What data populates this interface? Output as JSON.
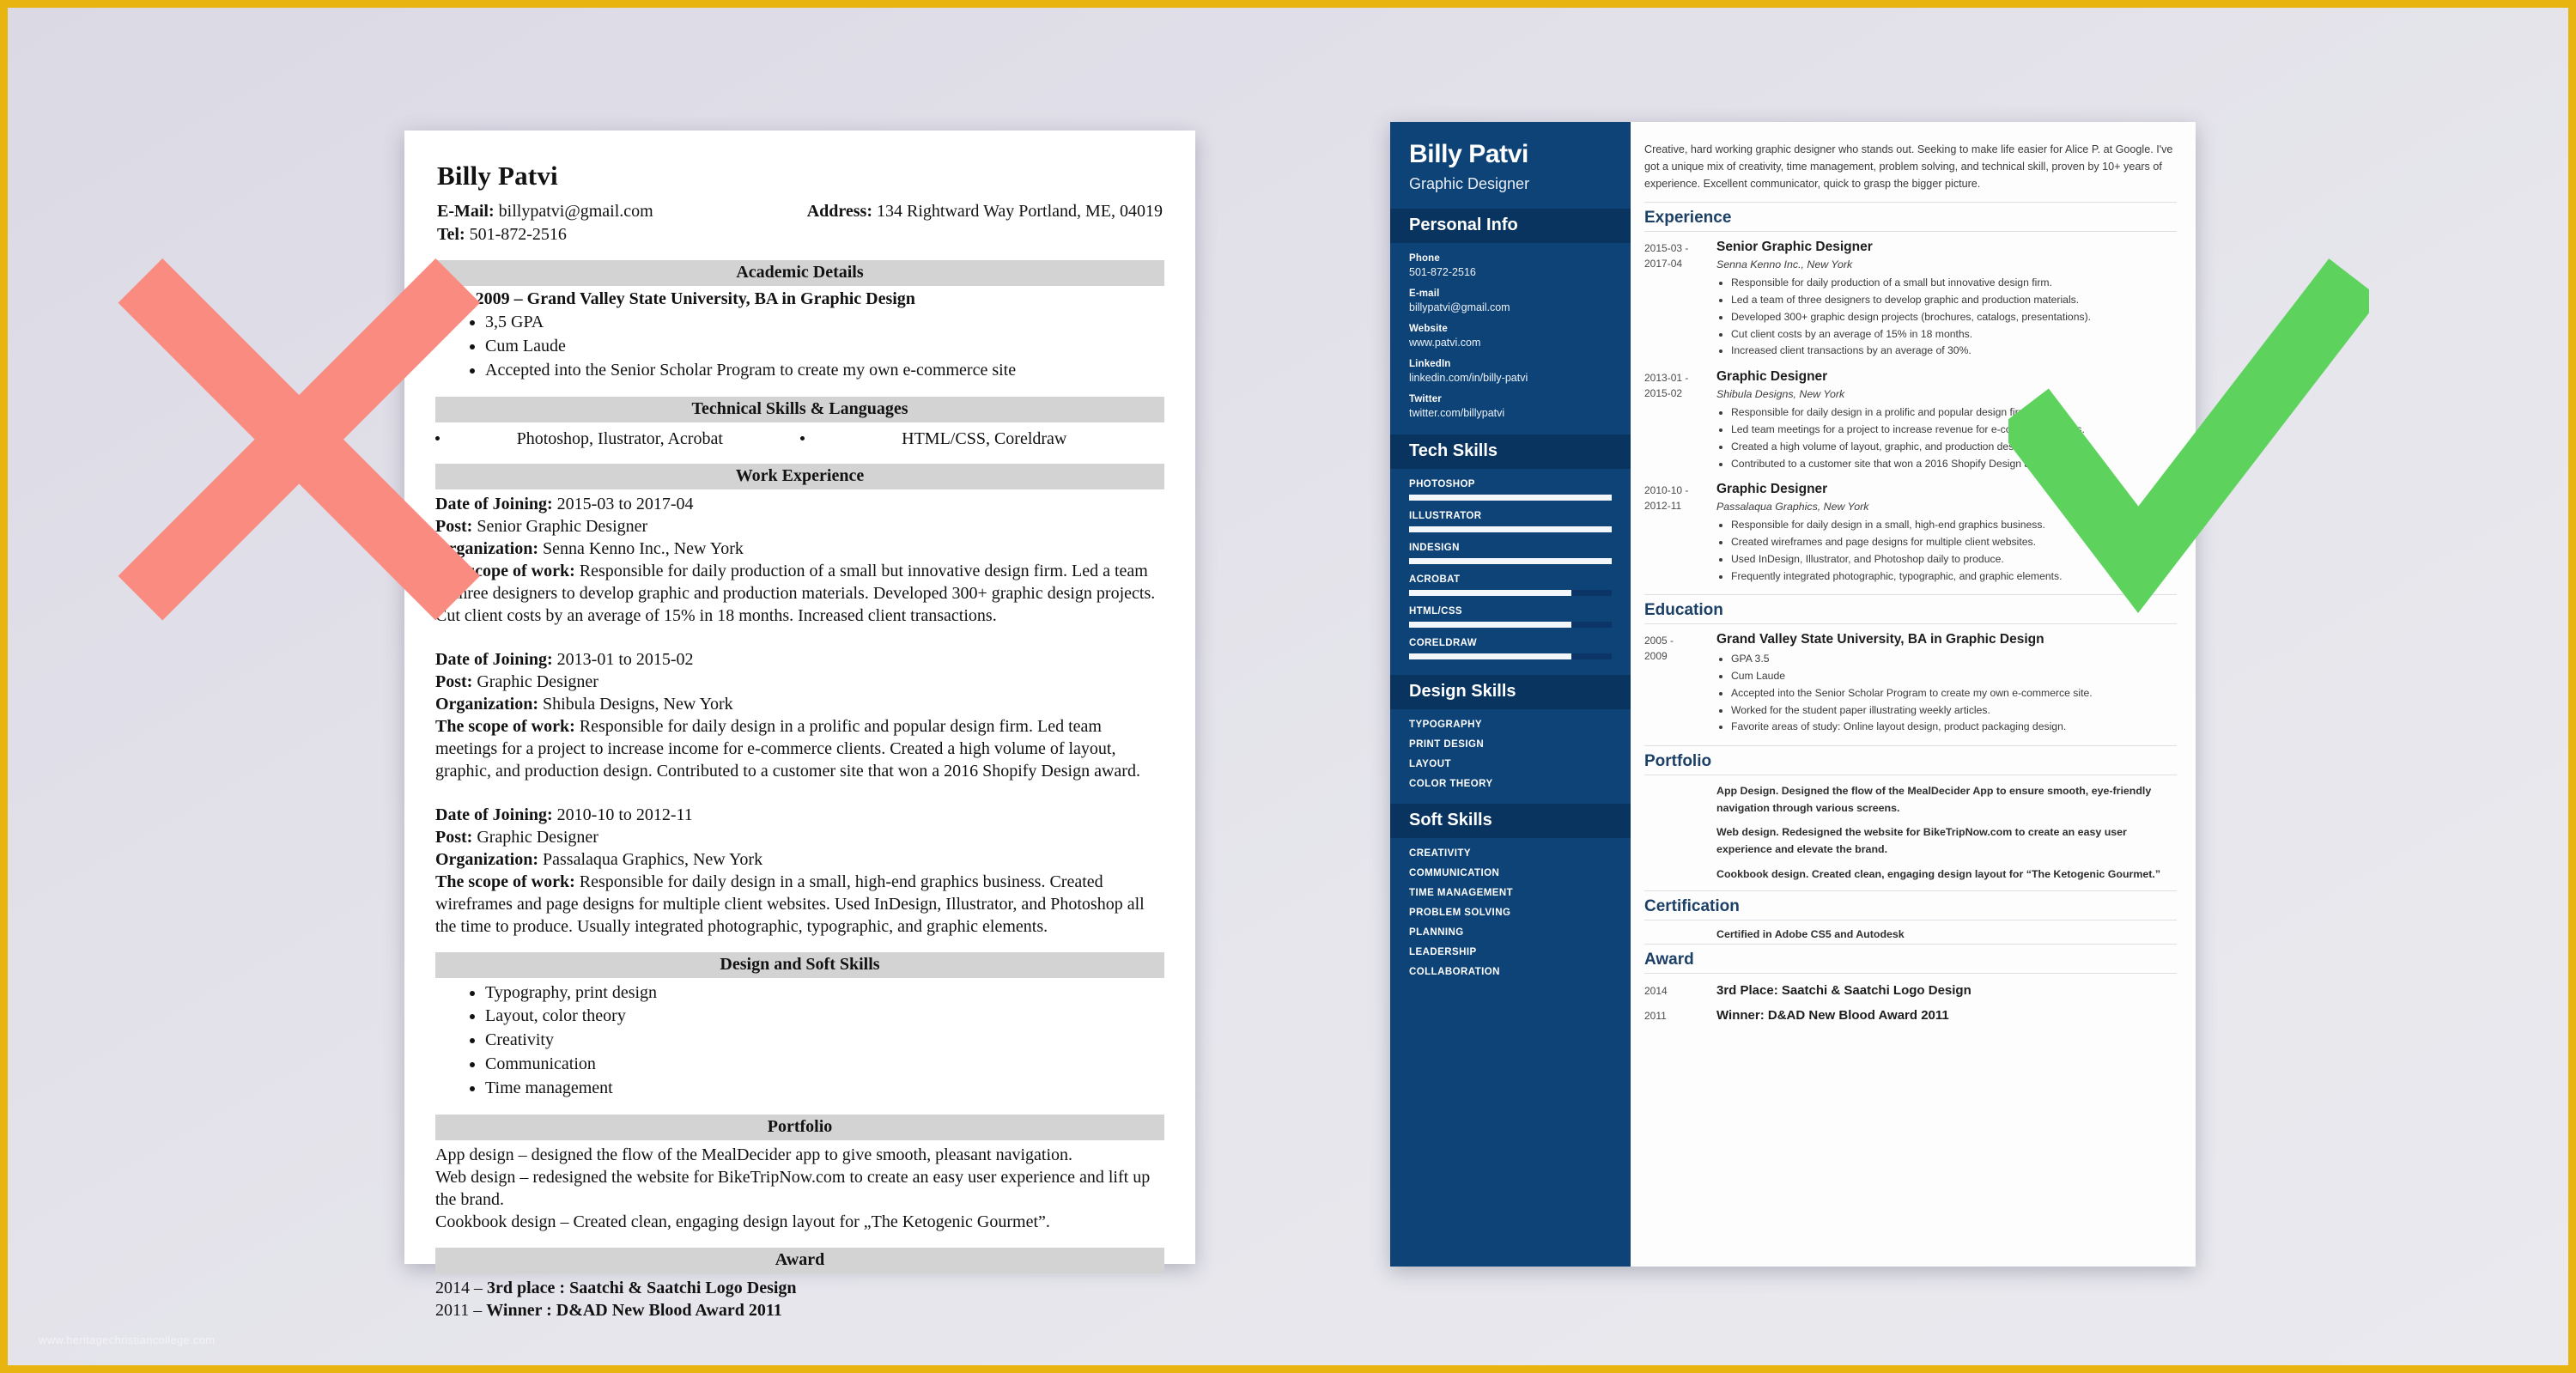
{
  "colors": {
    "frame_border": "#e8b410",
    "page_background": "#dedde6",
    "sidebar_blue": "#0e4377",
    "sidebar_header_blue": "#0a3460",
    "section_bar_grey": "#d3d3d3",
    "accent_heading_blue": "#1c3f66",
    "mark_x_red": "#f98b80",
    "mark_check_green": "#5dd35d"
  },
  "watermark": "www.heritagechristiancollege.com",
  "marks": {
    "bad": "x-mark",
    "good": "check-mark"
  },
  "bad_resume": {
    "name": "Billy Patvi",
    "email_label": "E-Mail:",
    "email": "billypatvi@gmail.com",
    "tel_label": "Tel:",
    "tel": "501-872-2516",
    "address_label": "Address:",
    "address": "134 Rightward Way Portland, ME, 04019",
    "sections": {
      "academic": {
        "title": "Academic Details",
        "heading": "2005-2009 – Grand Valley State University, BA in Graphic Design",
        "bullets": [
          "3,5 GPA",
          "Cum Laude",
          "Accepted into the Senior Scholar Program to create my own e-commerce site"
        ]
      },
      "technical": {
        "title": "Technical Skills & Languages",
        "col_left": "Photoshop, Ilustrator, Acrobat",
        "col_right": "HTML/CSS, Coreldraw"
      },
      "work": {
        "title": "Work Experience",
        "labels": {
          "date": "Date of Joining:",
          "post": "Post:",
          "organization": "Organization:",
          "scope": "The scope of work:"
        },
        "jobs": [
          {
            "date": "2015-03 to 2017-04",
            "post": "Senior Graphic Designer",
            "organization": "Senna Kenno Inc., New York",
            "scope": "Responsible for daily production of a small but innovative design firm. Led a team of three designers to develop graphic and production materials. Developed 300+ graphic design projects. Cut client costs by an average of 15% in 18 months. Increased client transactions."
          },
          {
            "date": "2013-01 to 2015-02",
            "post": "Graphic Designer",
            "organization": "Shibula Designs, New York",
            "scope": "Responsible for daily design in a prolific and popular design firm. Led team meetings for a project to increase income for e-commerce clients. Created a high volume of layout, graphic, and production design. Contributed to a customer site that won a 2016 Shopify Design award."
          },
          {
            "date": "2010-10 to 2012-11",
            "post": "Graphic Designer",
            "organization": "Passalaqua Graphics, New York",
            "scope": "Responsible for daily design in a small, high-end graphics business. Created wireframes and page designs for multiple client websites. Used InDesign, Illustrator, and Photoshop all the time to produce. Usually integrated photographic, typographic, and graphic elements."
          }
        ]
      },
      "design_soft_skills": {
        "title": "Design and Soft Skills",
        "bullets": [
          "Typography, print design",
          "Layout, color theory",
          "Creativity",
          "Communication",
          "Time management"
        ]
      },
      "portfolio": {
        "title": "Portfolio",
        "lines": [
          "App design – designed the flow of the MealDecider app to give smooth, pleasant navigation.",
          "Web design – redesigned the website for BikeTripNow.com to create an easy user experience and lift up the brand.",
          "Cookbook design – Created clean, engaging design layout for „The Ketogenic Gourmet”."
        ]
      },
      "award": {
        "title": "Award",
        "lines": [
          {
            "year": "2014 – ",
            "text": "3rd place : Saatchi & Saatchi Logo Design"
          },
          {
            "year": "2011 – ",
            "text": "Winner : D&AD New Blood Award 2011"
          }
        ]
      }
    }
  },
  "good_resume": {
    "sidebar": {
      "name": "Billy Patvi",
      "role": "Graphic Designer",
      "personal_info": {
        "title": "Personal Info",
        "items": [
          {
            "label": "Phone",
            "value": "501-872-2516"
          },
          {
            "label": "E-mail",
            "value": "billypatvi@gmail.com"
          },
          {
            "label": "Website",
            "value": "www.patvi.com"
          },
          {
            "label": "LinkedIn",
            "value": "linkedin.com/in/billy-patvi"
          },
          {
            "label": "Twitter",
            "value": "twitter.com/billypatvi"
          }
        ]
      },
      "tech_skills": {
        "title": "Tech Skills",
        "items": [
          {
            "name": "PHOTOSHOP",
            "level": 100
          },
          {
            "name": "ILLUSTRATOR",
            "level": 100
          },
          {
            "name": "INDESIGN",
            "level": 100
          },
          {
            "name": "ACROBAT",
            "level": 80
          },
          {
            "name": "HTML/CSS",
            "level": 80
          },
          {
            "name": "CORELDRAW",
            "level": 80
          }
        ]
      },
      "design_skills": {
        "title": "Design Skills",
        "items": [
          "TYPOGRAPHY",
          "PRINT DESIGN",
          "LAYOUT",
          "COLOR THEORY"
        ]
      },
      "soft_skills": {
        "title": "Soft Skills",
        "items": [
          "CREATIVITY",
          "COMMUNICATION",
          "TIME MANAGEMENT",
          "PROBLEM SOLVING",
          "PLANNING",
          "LEADERSHIP",
          "COLLABORATION"
        ]
      }
    },
    "main": {
      "summary": "Creative, hard working graphic designer who stands out. Seeking to make life easier for Alice P. at Google. I've got a unique mix of creativity, time management, problem solving, and technical skill, proven by 10+ years of experience. Excellent communicator, quick to grasp the bigger picture.",
      "experience": {
        "title": "Experience",
        "entries": [
          {
            "date_from": "2015-03 -",
            "date_to": "2017-04",
            "title": "Senior Graphic Designer",
            "org": "Senna Kenno Inc., New York",
            "bullets": [
              "Responsible for daily production of a small but innovative design firm.",
              "Led a team of three designers to develop graphic and production materials.",
              "Developed 300+ graphic design projects (brochures, catalogs, presentations).",
              "Cut client costs by an average of 15% in 18 months.",
              "Increased client transactions by an average of 30%."
            ]
          },
          {
            "date_from": "2013-01 -",
            "date_to": "2015-02",
            "title": "Graphic Designer",
            "org": "Shibula Designs, New York",
            "bullets": [
              "Responsible for daily design in a prolific and popular design firm.",
              "Led team meetings for a project to increase revenue for e-commerce clients.",
              "Created a high volume of layout, graphic, and production design.",
              "Contributed to a customer site that won a 2016 Shopify Design award."
            ]
          },
          {
            "date_from": "2010-10 -",
            "date_to": "2012-11",
            "title": "Graphic Designer",
            "org": "Passalaqua Graphics, New York",
            "bullets": [
              "Responsible for daily design in a small, high-end graphics business.",
              "Created wireframes and page designs for multiple client websites.",
              "Used InDesign, Illustrator, and Photoshop daily to produce.",
              "Frequently integrated photographic, typographic, and graphic elements."
            ]
          }
        ]
      },
      "education": {
        "title": "Education",
        "entries": [
          {
            "date_from": "2005 -",
            "date_to": "2009",
            "title": "Grand Valley State University, BA in Graphic Design",
            "bullets": [
              "GPA 3.5",
              "Cum Laude",
              "Accepted into the Senior Scholar Program to create my own e-commerce site.",
              "Worked for the student paper illustrating weekly articles.",
              "Favorite areas of study: Online layout design, product packaging design."
            ]
          }
        ]
      },
      "portfolio": {
        "title": "Portfolio",
        "paragraphs": [
          "App Design. Designed the flow of the MealDecider App to ensure smooth, eye-friendly navigation through various screens.",
          "Web design. Redesigned the website for BikeTripNow.com to create an easy user experience and elevate the brand.",
          "Cookbook design. Created clean, engaging design layout for “The Ketogenic Gourmet.”"
        ]
      },
      "certification": {
        "title": "Certification",
        "items": [
          "Certified in Adobe CS5 and Autodesk"
        ]
      },
      "award": {
        "title": "Award",
        "entries": [
          {
            "year": "2014",
            "text": "3rd Place: Saatchi & Saatchi Logo Design"
          },
          {
            "year": "2011",
            "text": "Winner: D&AD New Blood Award 2011"
          }
        ]
      }
    }
  }
}
